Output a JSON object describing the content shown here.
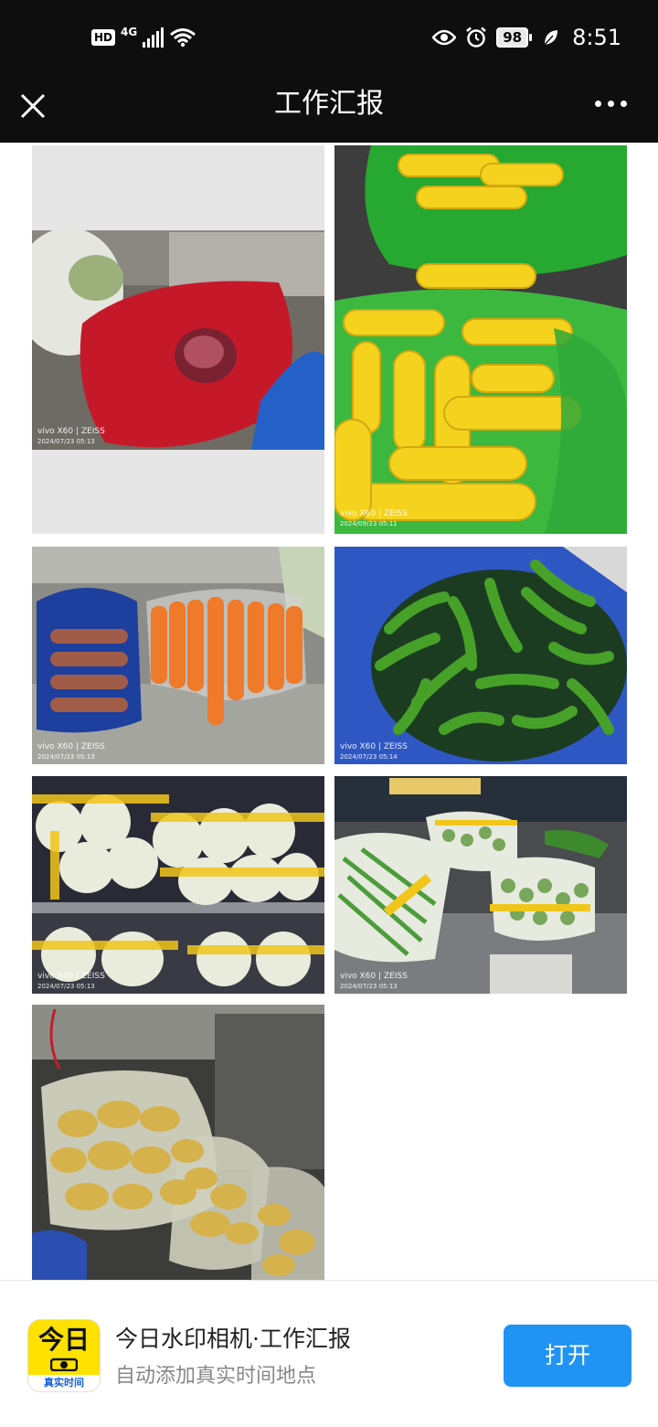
{
  "status_bar": {
    "hd": "HD",
    "network": "4G",
    "battery": "98",
    "time": "8:51"
  },
  "nav": {
    "title": "工作汇报"
  },
  "photos": [
    {
      "subject": "red onions in red mesh bag",
      "watermark_model": "vivo X60 | ZEISS",
      "watermark_date": "2024/07/23 05:13"
    },
    {
      "subject": "corn cobs in green bag",
      "watermark_model": "vivo X60 | ZEISS",
      "watermark_date": "2024/09/23 05:11"
    },
    {
      "subject": "carrots in plastic bags",
      "watermark_model": "vivo X60 | ZEISS",
      "watermark_date": "2024/07/23 05:13"
    },
    {
      "subject": "green chili peppers in blue bag",
      "watermark_model": "vivo X60 | ZEISS",
      "watermark_date": "2024/07/23 05:14"
    },
    {
      "subject": "wrapped cabbages on shelves",
      "watermark_model": "vivo X60 | ZEISS",
      "watermark_date": "2024/07/23 05:13"
    },
    {
      "subject": "green beans and okra in bags",
      "watermark_model": "vivo X60 | ZEISS",
      "watermark_date": "2024/07/23 05:13"
    },
    {
      "subject": "ginger in plastic bags",
      "watermark_model": "",
      "watermark_date": ""
    }
  ],
  "footer": {
    "icon_big_text": "今日",
    "icon_small_text": "真实时间",
    "app_name": "今日水印相机·工作汇报",
    "app_subtitle": "自动添加真实时间地点",
    "open_button": "打开"
  },
  "colors": {
    "bar_bg": "#0e0e0e",
    "button_blue": "#2093f5",
    "icon_yellow": "#ffe100"
  }
}
